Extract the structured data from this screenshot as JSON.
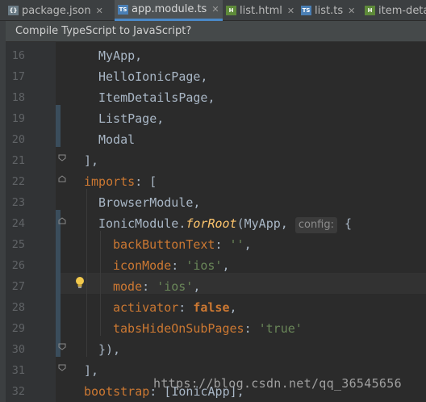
{
  "tabs": [
    {
      "label": "package.json",
      "icon": "json-file-icon",
      "type": "json",
      "active": false
    },
    {
      "label": "app.module.ts",
      "icon": "ts-file-icon",
      "type": "ts",
      "active": true
    },
    {
      "label": "list.html",
      "icon": "html-file-icon",
      "type": "html",
      "active": false
    },
    {
      "label": "list.ts",
      "icon": "ts-file-icon",
      "type": "ts",
      "active": false
    },
    {
      "label": "item-detai",
      "icon": "ts-file-icon",
      "type": "ts",
      "active": false
    }
  ],
  "banner": {
    "text": "Compile TypeScript to JavaScript?"
  },
  "line_numbers": [
    "16",
    "17",
    "18",
    "19",
    "20",
    "21",
    "22",
    "23",
    "24",
    "25",
    "26",
    "27",
    "28",
    "29",
    "30",
    "31",
    "32"
  ],
  "code": {
    "l16": "MyApp,",
    "l17": "HelloIonicPage,",
    "l18": "ItemDetailsPage,",
    "l19": "ListPage,",
    "l20": "Modal",
    "l21": "],",
    "l22_a": "imports",
    "l22_b": ": [",
    "l23": "BrowserModule,",
    "l24_a": "IonicModule.",
    "l24_fn": "forRoot",
    "l24_b": "(MyApp,",
    "l24_hint": "config:",
    "l24_c": "{",
    "l25_key": "backButtonText",
    "l25_str": "''",
    "l26_key": "iconMode",
    "l26_str": "'ios'",
    "l27_key": "mode",
    "l27_str": "'ios'",
    "l28_key": "activator",
    "l28_bool": "false",
    "l29_key": "tabsHideOnSubPages",
    "l29_str": "'true'",
    "l30": "}),",
    "l31": "],",
    "l32_a": "bootstrap",
    "l32_b": ": [IonicApp],"
  },
  "watermark": "https://blog.csdn.net/qq_36545656",
  "colors": {
    "keyword": "#cc7832",
    "string": "#6a8759",
    "function": "#ffc66d",
    "text": "#a9b7c6",
    "background": "#2b2b2b"
  }
}
